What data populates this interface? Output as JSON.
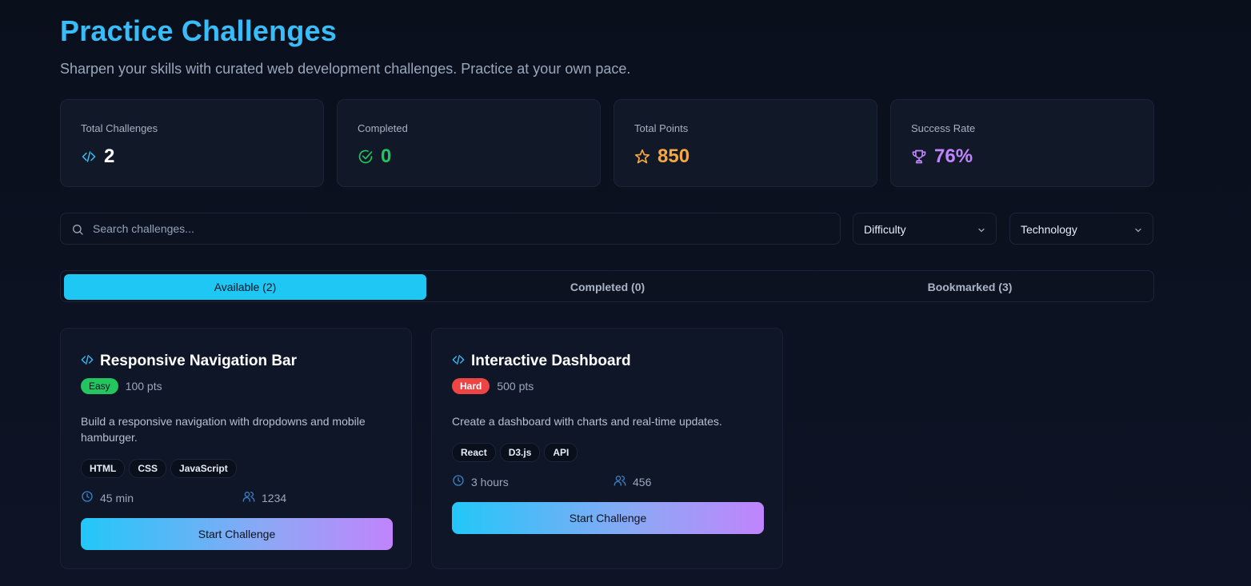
{
  "header": {
    "title": "Practice Challenges",
    "subtitle": "Sharpen your skills with curated web development challenges. Practice at your own pace."
  },
  "stats": [
    {
      "label": "Total Challenges",
      "value": "2",
      "icon": "code-icon",
      "color": "#ffffff",
      "icon_color": "#38bdf8"
    },
    {
      "label": "Completed",
      "value": "0",
      "icon": "check-circle-icon",
      "color": "#22c55e",
      "icon_color": "#22c55e"
    },
    {
      "label": "Total Points",
      "value": "850",
      "icon": "star-icon",
      "color": "#f5a742",
      "icon_color": "#f5a742"
    },
    {
      "label": "Success Rate",
      "value": "76%",
      "icon": "trophy-icon",
      "color": "#c084fc",
      "icon_color": "#c084fc"
    }
  ],
  "search": {
    "placeholder": "Search challenges...",
    "value": ""
  },
  "filters": {
    "difficulty": "Difficulty",
    "technology": "Technology"
  },
  "tabs": [
    {
      "label": "Available (2)",
      "active": true
    },
    {
      "label": "Completed (0)",
      "active": false
    },
    {
      "label": "Bookmarked (3)",
      "active": false
    }
  ],
  "challenges": [
    {
      "title": "Responsive Navigation Bar",
      "difficulty": "Easy",
      "difficulty_color": "#22c55e",
      "points": "100 pts",
      "description": "Build a responsive navigation with dropdowns and mobile hamburger.",
      "tags": [
        "HTML",
        "CSS",
        "JavaScript"
      ],
      "duration": "45 min",
      "participants": "1234",
      "button": "Start Challenge"
    },
    {
      "title": "Interactive Dashboard",
      "difficulty": "Hard",
      "difficulty_color": "#ef4444",
      "points": "500 pts",
      "description": "Create a dashboard with charts and real-time updates.",
      "tags": [
        "React",
        "D3.js",
        "API"
      ],
      "duration": "3 hours",
      "participants": "456",
      "button": "Start Challenge"
    }
  ],
  "colors": {
    "accent": "#38bdf8",
    "background": "#0d1220"
  }
}
